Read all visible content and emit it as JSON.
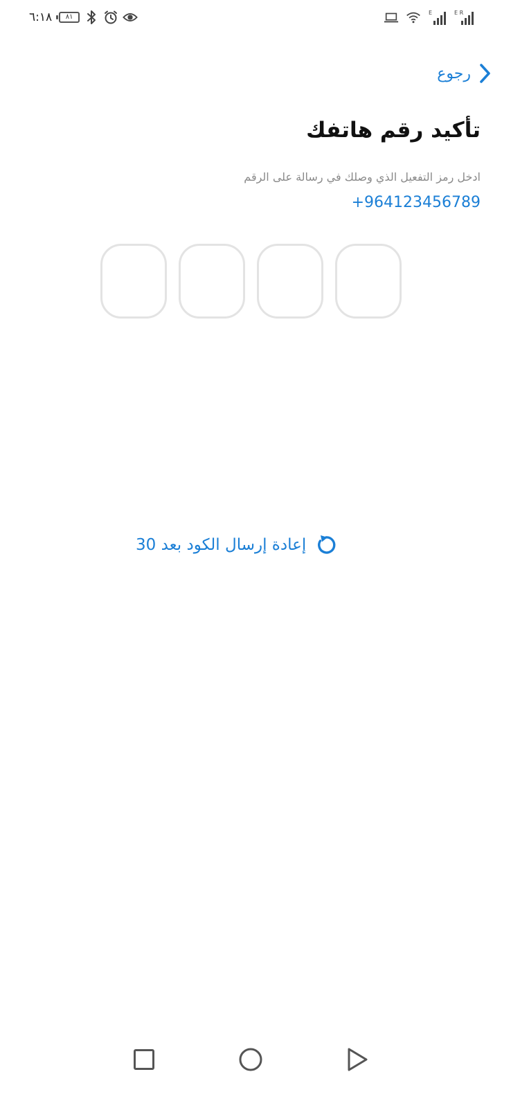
{
  "status_bar": {
    "time": "٦:١٨",
    "battery_level": "٨١",
    "left_icons": [
      "battery-icon",
      "bluetooth-icon",
      "alarm-icon",
      "eye-comfort-icon"
    ],
    "right_icons": [
      "laptop-icon",
      "wifi-icon",
      "signal-1-icon",
      "signal-2-icon"
    ],
    "signal_1_label": "E",
    "signal_2_label": "E R"
  },
  "header": {
    "back_label": "رجوع",
    "back_icon": "chevron-right-icon"
  },
  "main": {
    "title": "تأكيد رقم هاتفك",
    "instruction": "ادخل رمز التفعيل الذي وصلك في رسالة على الرقم",
    "phone_number": "+964123456789",
    "otp_length": 4,
    "otp_values": [
      "",
      "",
      "",
      ""
    ]
  },
  "resend": {
    "label": "إعادة إرسال الكود بعد 30",
    "icon": "refresh-icon"
  },
  "nav_bar": {
    "icons": [
      "recents-square-icon",
      "home-circle-icon",
      "back-triangle-icon"
    ]
  },
  "colors": {
    "accent": "#1b7fd6",
    "title": "#111111",
    "muted": "#8a8a8a",
    "otp_border": "#e3e3e3",
    "background": "#ffffff"
  }
}
